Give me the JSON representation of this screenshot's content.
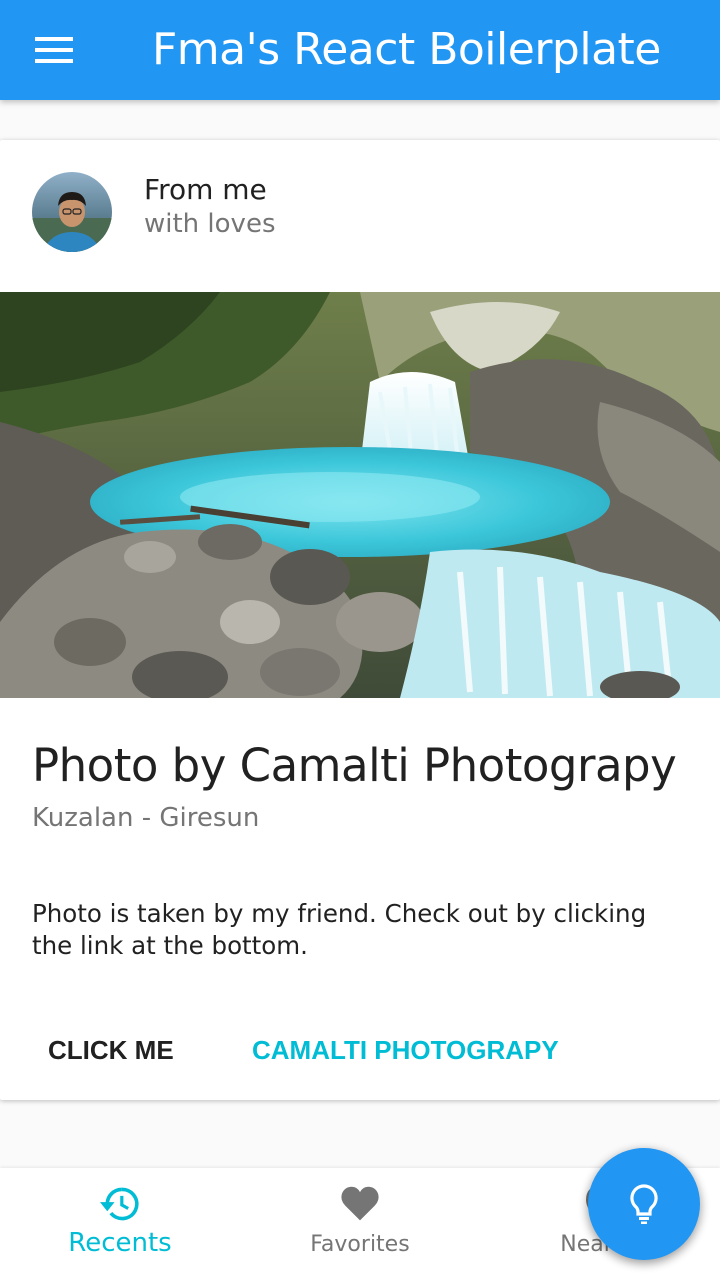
{
  "app_bar": {
    "title": "Fma's React Boilerplate",
    "menu_icon": "menu-icon",
    "color": "#2196f3"
  },
  "card": {
    "header": {
      "title": "From me",
      "subtitle": "with loves"
    },
    "media_alt": "waterfall landscape photo",
    "title": "Photo by Camalti Photograpy",
    "subtitle": "Kuzalan - Giresun",
    "text": "Photo is taken by my friend. Check out by clicking the link at the bottom.",
    "actions": [
      {
        "label": "Click me"
      },
      {
        "label": "Camalti Photograpy",
        "color": "#00bcd4"
      }
    ]
  },
  "bottom_nav": {
    "items": [
      {
        "label": "Recents",
        "icon": "history-icon",
        "active": true
      },
      {
        "label": "Favorites",
        "icon": "heart-icon",
        "active": false
      },
      {
        "label": "Nearby",
        "icon": "location-icon",
        "active": false
      }
    ],
    "active_color": "#00bcd4"
  },
  "fab": {
    "icon": "lightbulb-icon",
    "color": "#2196f3"
  }
}
